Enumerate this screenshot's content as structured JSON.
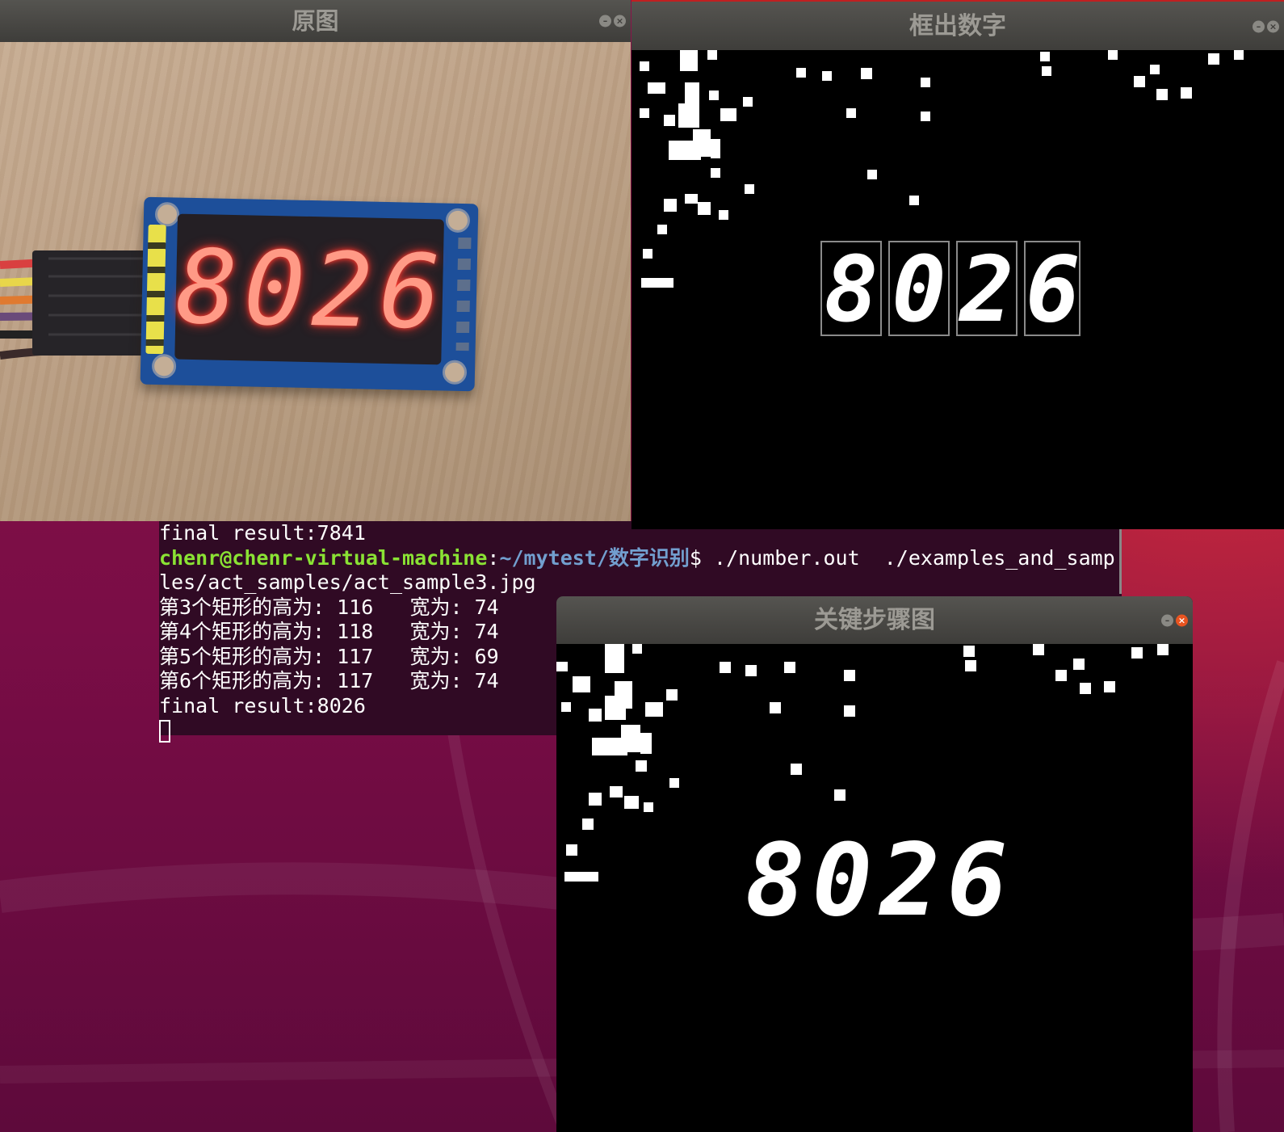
{
  "windows": {
    "original": {
      "title": "原图",
      "photo_display_text": "8026"
    },
    "boxed": {
      "title": "框出数字",
      "digits": [
        "8",
        "0",
        "2",
        "6"
      ]
    },
    "steps": {
      "title": "关键步骤图",
      "digits": [
        "8",
        "0",
        "2",
        "6"
      ]
    }
  },
  "terminal": {
    "prev_line": "final result:7841",
    "prompt_user": "chenr@chenr-virtual-machine",
    "prompt_sep": ":",
    "prompt_path": "~/mytest/数字识别",
    "prompt_cmd": "$ ./number.out  ./examples_and_samp",
    "cmd_wrap": "les/act_samples/act_sample3.jpg",
    "output": [
      "第3个矩形的高为: 116   宽为: 74",
      "第4个矩形的高为: 118   宽为: 74",
      "第5个矩形的高为: 117   宽为: 69",
      "第6个矩形的高为: 117   宽为: 74"
    ],
    "final": "final result:8026"
  },
  "icons": {
    "minimize": "–",
    "close": "×"
  },
  "colors": {
    "terminal_bg": "#300a24",
    "prompt_user": "#8ae234",
    "prompt_path": "#729fcf",
    "title_bar": "#3e3d3a",
    "close_active": "#e95420",
    "led": "#ff3b30"
  }
}
